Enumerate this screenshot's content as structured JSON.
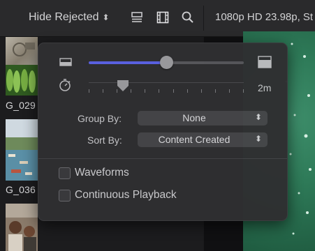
{
  "toolbar": {
    "filter_label": "Hide Rejected",
    "filter_chevron": "⌃⌄",
    "format_text": "1080p HD 23.98p, St",
    "icons": [
      "list-view-icon",
      "filmstrip-icon",
      "search-icon"
    ]
  },
  "browser": {
    "clip_labels": [
      "G_029",
      "G_036"
    ]
  },
  "popover": {
    "clip_height_slider_value": 0.5,
    "duration_slider_value": 0.22,
    "duration_value": "2m",
    "group_by": {
      "label": "Group By:",
      "value": "None"
    },
    "sort_by": {
      "label": "Sort By:",
      "value": "Content Created"
    },
    "waveforms": {
      "label": "Waveforms",
      "checked": false
    },
    "continuous_playback": {
      "label": "Continuous Playback",
      "checked": false
    },
    "accent_color": "#5b63e6"
  }
}
